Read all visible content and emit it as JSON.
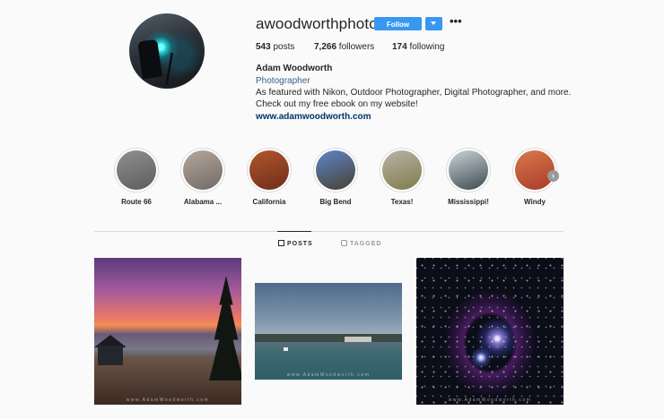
{
  "profile": {
    "username": "awoodworthphoto",
    "follow_label": "Follow",
    "more_label": "•••",
    "stats": {
      "posts_count": "543",
      "posts_label": " posts",
      "followers_count": "7,266",
      "followers_label": " followers",
      "following_count": "174",
      "following_label": " following"
    },
    "full_name": "Adam Woodworth",
    "category": "Photographer",
    "bio_lines": [
      "As featured with Nikon, Outdoor Photographer, Digital Photographer, and more.",
      "Check out my free ebook on my website!"
    ],
    "website": "www.adamwoodworth.com"
  },
  "highlights": [
    {
      "label": "Route 66",
      "colors": [
        "#8f8f8f",
        "#5d5d5d"
      ]
    },
    {
      "label": "Alabama ...",
      "colors": [
        "#b7a79a",
        "#6e6a68"
      ]
    },
    {
      "label": "California",
      "colors": [
        "#b2562c",
        "#6e2e1a"
      ]
    },
    {
      "label": "Big Bend",
      "colors": [
        "#5c86c9",
        "#4a4032"
      ]
    },
    {
      "label": "Texas!",
      "colors": [
        "#b9b3a8",
        "#7e7c48"
      ]
    },
    {
      "label": "Mississippi!",
      "colors": [
        "#c9d3d8",
        "#3f4a50"
      ]
    },
    {
      "label": "Windy",
      "colors": [
        "#d9794a",
        "#a83b2a"
      ]
    }
  ],
  "highlights_next_label": "›",
  "tabs": {
    "posts": "POSTS",
    "tagged": "TAGGED"
  },
  "posts": [
    {
      "watermark": "www.AdamWoodworth.com"
    },
    {
      "watermark": "www.AdamWoodworth.com"
    },
    {
      "watermark": "www.AdamWoodworth.com"
    }
  ]
}
